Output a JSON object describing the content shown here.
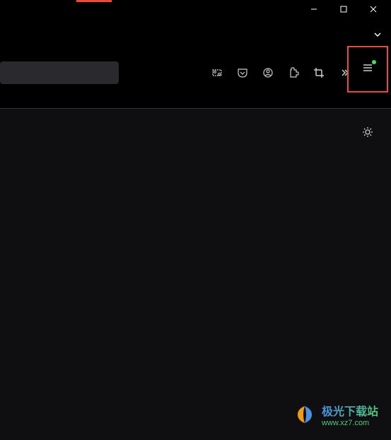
{
  "window": {
    "minimize": "−",
    "maximize": "□",
    "close": "✕"
  },
  "toolbar": {
    "search_placeholder": "",
    "icons": {
      "screenshot": "screenshot-icon",
      "pocket": "pocket-icon",
      "account": "account-icon",
      "extension": "extension-icon",
      "crop": "crop-icon",
      "more": "more-icon",
      "menu": "menu-icon"
    }
  },
  "content": {
    "settings": "settings-icon"
  },
  "watermark": {
    "title": "极光下载站",
    "url": "www.xz7.com"
  },
  "highlight": {
    "color": "#e74c3c"
  }
}
